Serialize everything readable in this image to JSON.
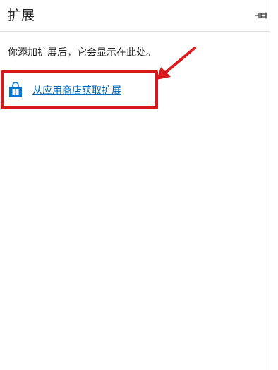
{
  "panel": {
    "title": "扩展",
    "pin_icon": "pin-icon",
    "empty_message": "你添加扩展后，它会显示在此处。",
    "store_link": {
      "icon": "store-bag-icon",
      "label": "从应用商店获取扩展",
      "color": "#0067b8"
    }
  },
  "annotation": {
    "color": "#d7191c"
  }
}
